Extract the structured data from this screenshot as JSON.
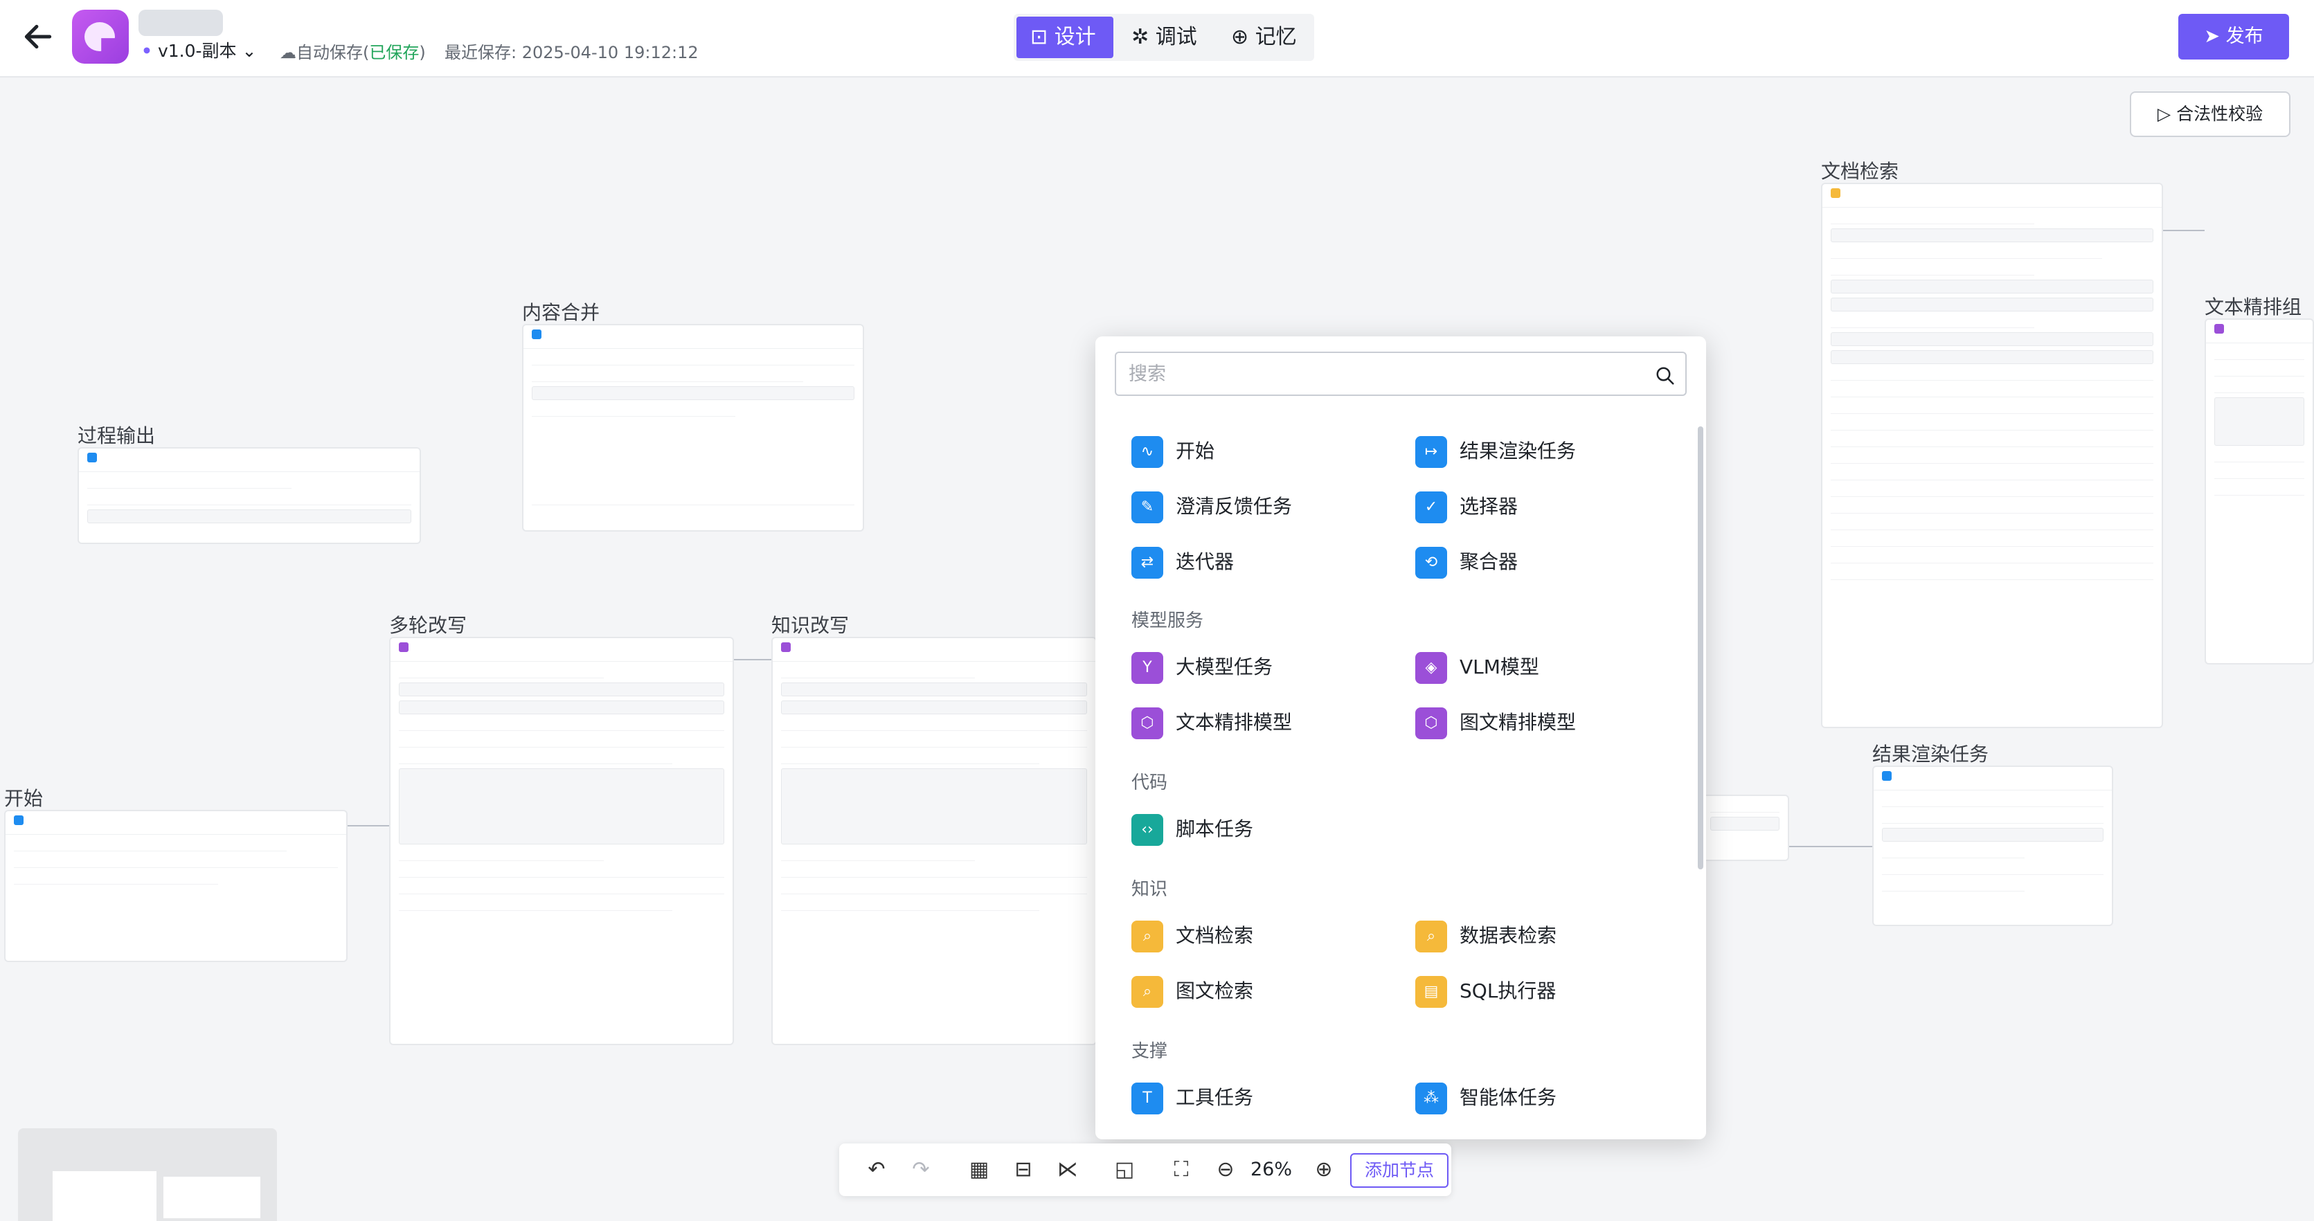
{
  "header": {
    "version": "v1.0-副本",
    "autosave_prefix": "自动保存(",
    "autosave_status": "已保存",
    "autosave_suffix": ")",
    "last_saved": "最近保存: 2025-04-10 19:12:12",
    "modes": [
      "设计",
      "调试",
      "记忆"
    ],
    "active_mode": "设计",
    "publish": "发布"
  },
  "canvas": {
    "validate": "合法性校验",
    "nodes": [
      {
        "title": "开始"
      },
      {
        "title": "过程输出"
      },
      {
        "title": "内容合并"
      },
      {
        "title": "多轮改写"
      },
      {
        "title": "知识改写"
      },
      {
        "title": "文档检索"
      },
      {
        "title": "文本精排组合"
      },
      {
        "title": "结果渲染任务"
      }
    ]
  },
  "node_menu": {
    "search_placeholder": "搜索",
    "sections": [
      {
        "title": "",
        "items": [
          {
            "label": "开始",
            "icon": "pulse-icon",
            "color": "#1e8cf0"
          },
          {
            "label": "结果渲染任务",
            "icon": "arrow-right-icon",
            "color": "#1e8cf0"
          },
          {
            "label": "澄清反馈任务",
            "icon": "edit-icon",
            "color": "#1e8cf0"
          },
          {
            "label": "选择器",
            "icon": "check-icon",
            "color": "#1e8cf0"
          },
          {
            "label": "迭代器",
            "icon": "loop-icon",
            "color": "#1e8cf0"
          },
          {
            "label": "聚合器",
            "icon": "merge-icon",
            "color": "#1e8cf0"
          }
        ]
      },
      {
        "title": "模型服务",
        "items": [
          {
            "label": "大模型任务",
            "icon": "model-icon",
            "color": "#9b4fd8"
          },
          {
            "label": "VLM模型",
            "icon": "vlm-icon",
            "color": "#9b4fd8"
          },
          {
            "label": "文本精排模型",
            "icon": "rerank-icon",
            "color": "#9b4fd8"
          },
          {
            "label": "图文精排模型",
            "icon": "image-rerank-icon",
            "color": "#9b4fd8"
          }
        ]
      },
      {
        "title": "代码",
        "items": [
          {
            "label": "脚本任务",
            "icon": "code-icon",
            "color": "#18a89a"
          }
        ]
      },
      {
        "title": "知识",
        "items": [
          {
            "label": "文档检索",
            "icon": "doc-search-icon",
            "color": "#f5b93a"
          },
          {
            "label": "数据表检索",
            "icon": "table-search-icon",
            "color": "#f5b93a"
          },
          {
            "label": "图文检索",
            "icon": "image-search-icon",
            "color": "#f5b93a"
          },
          {
            "label": "SQL执行器",
            "icon": "sql-icon",
            "color": "#f5b93a"
          }
        ]
      },
      {
        "title": "支撑",
        "items": [
          {
            "label": "工具任务",
            "icon": "tool-icon",
            "color": "#1e8cf0"
          },
          {
            "label": "智能体任务",
            "icon": "agent-icon",
            "color": "#1e8cf0"
          }
        ]
      }
    ]
  },
  "toolbar": {
    "zoom": "26%",
    "add_node": "添加节点"
  }
}
